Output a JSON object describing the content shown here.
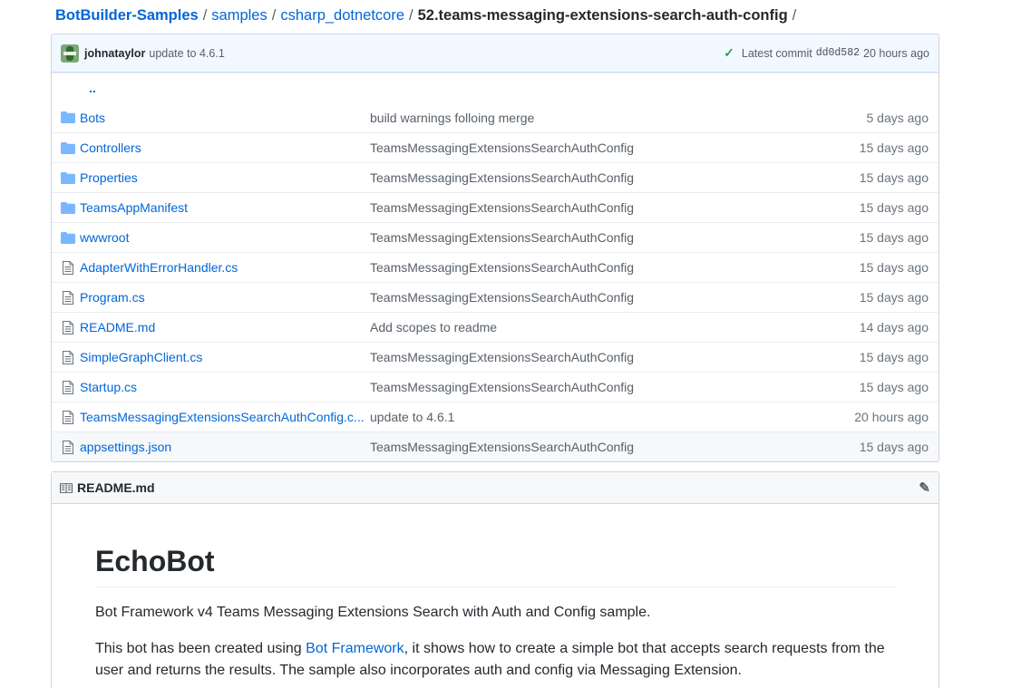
{
  "breadcrumb": {
    "repo": "BotBuilder-Samples",
    "part1": "samples",
    "part2": "csharp_dotnetcore",
    "current": "52.teams-messaging-extensions-search-auth-config",
    "separator": "/"
  },
  "commit": {
    "author": "johnataylor",
    "message": "update to 4.6.1",
    "latest_label": "Latest commit",
    "sha": "dd0d582",
    "age": "20 hours ago"
  },
  "up_link": "..",
  "files": [
    {
      "type": "folder",
      "name": "Bots",
      "message": "build warnings folloing merge",
      "age": "5 days ago"
    },
    {
      "type": "folder",
      "name": "Controllers",
      "message": "TeamsMessagingExtensionsSearchAuthConfig",
      "age": "15 days ago"
    },
    {
      "type": "folder",
      "name": "Properties",
      "message": "TeamsMessagingExtensionsSearchAuthConfig",
      "age": "15 days ago"
    },
    {
      "type": "folder",
      "name": "TeamsAppManifest",
      "message": "TeamsMessagingExtensionsSearchAuthConfig",
      "age": "15 days ago"
    },
    {
      "type": "folder",
      "name": "wwwroot",
      "message": "TeamsMessagingExtensionsSearchAuthConfig",
      "age": "15 days ago"
    },
    {
      "type": "file",
      "name": "AdapterWithErrorHandler.cs",
      "message": "TeamsMessagingExtensionsSearchAuthConfig",
      "age": "15 days ago"
    },
    {
      "type": "file",
      "name": "Program.cs",
      "message": "TeamsMessagingExtensionsSearchAuthConfig",
      "age": "15 days ago"
    },
    {
      "type": "file",
      "name": "README.md",
      "message": "Add scopes to readme",
      "age": "14 days ago"
    },
    {
      "type": "file",
      "name": "SimpleGraphClient.cs",
      "message": "TeamsMessagingExtensionsSearchAuthConfig",
      "age": "15 days ago"
    },
    {
      "type": "file",
      "name": "Startup.cs",
      "message": "TeamsMessagingExtensionsSearchAuthConfig",
      "age": "15 days ago"
    },
    {
      "type": "file",
      "name": "TeamsMessagingExtensionsSearchAuthConfig.c...",
      "message": "update to 4.6.1",
      "age": "20 hours ago"
    },
    {
      "type": "file",
      "name": "appsettings.json",
      "message": "TeamsMessagingExtensionsSearchAuthConfig",
      "age": "15 days ago"
    }
  ],
  "readme": {
    "filename": "README.md",
    "title": "EchoBot",
    "para1": "Bot Framework v4 Teams Messaging Extensions Search with Auth and Config sample.",
    "para2_before": "This bot has been created using ",
    "para2_link": "Bot Framework",
    "para2_after": ", it shows how to create a simple bot that accepts search requests from the user and returns the results. The sample also incorporates auth and config via Messaging Extension."
  },
  "colors": {
    "link": "#0366d6",
    "commit_bg": "#f1f8ff",
    "check": "#28a745",
    "folder": "#79b8ff"
  }
}
